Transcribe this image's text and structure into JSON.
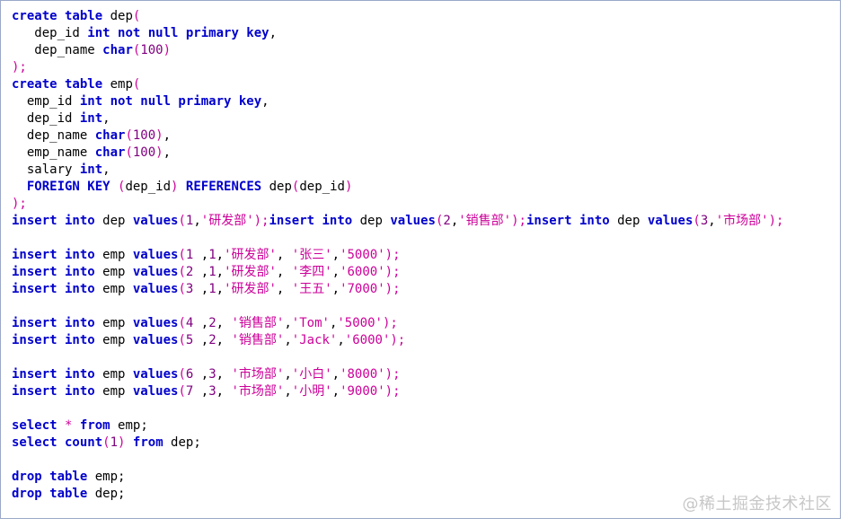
{
  "editor": {
    "lines": [
      [
        {
          "t": "kw",
          "v": "create table"
        },
        {
          "t": "fn",
          "v": " dep"
        },
        {
          "t": "op",
          "v": "("
        }
      ],
      [
        {
          "t": "fn",
          "v": "   dep_id "
        },
        {
          "t": "kw",
          "v": "int not null primary key"
        },
        {
          "t": "punc",
          "v": ","
        }
      ],
      [
        {
          "t": "fn",
          "v": "   dep_name "
        },
        {
          "t": "kw",
          "v": "char"
        },
        {
          "t": "op",
          "v": "("
        },
        {
          "t": "num",
          "v": "100"
        },
        {
          "t": "op",
          "v": ")"
        }
      ],
      [
        {
          "t": "op",
          "v": ");"
        }
      ],
      [
        {
          "t": "kw",
          "v": "create table"
        },
        {
          "t": "fn",
          "v": " emp"
        },
        {
          "t": "op",
          "v": "("
        }
      ],
      [
        {
          "t": "fn",
          "v": "  emp_id "
        },
        {
          "t": "kw",
          "v": "int not null primary key"
        },
        {
          "t": "punc",
          "v": ","
        }
      ],
      [
        {
          "t": "fn",
          "v": "  dep_id "
        },
        {
          "t": "kw",
          "v": "int"
        },
        {
          "t": "punc",
          "v": ","
        }
      ],
      [
        {
          "t": "fn",
          "v": "  dep_name "
        },
        {
          "t": "kw",
          "v": "char"
        },
        {
          "t": "op",
          "v": "("
        },
        {
          "t": "num",
          "v": "100"
        },
        {
          "t": "op",
          "v": ")"
        },
        {
          "t": "punc",
          "v": ","
        }
      ],
      [
        {
          "t": "fn",
          "v": "  emp_name "
        },
        {
          "t": "kw",
          "v": "char"
        },
        {
          "t": "op",
          "v": "("
        },
        {
          "t": "num",
          "v": "100"
        },
        {
          "t": "op",
          "v": ")"
        },
        {
          "t": "punc",
          "v": ","
        }
      ],
      [
        {
          "t": "fn",
          "v": "  salary "
        },
        {
          "t": "kw",
          "v": "int"
        },
        {
          "t": "punc",
          "v": ","
        }
      ],
      [
        {
          "t": "kw",
          "v": "  FOREIGN KEY"
        },
        {
          "t": "fn",
          "v": " "
        },
        {
          "t": "op",
          "v": "("
        },
        {
          "t": "fn",
          "v": "dep_id"
        },
        {
          "t": "op",
          "v": ")"
        },
        {
          "t": "fn",
          "v": " "
        },
        {
          "t": "kw",
          "v": "REFERENCES"
        },
        {
          "t": "fn",
          "v": " dep"
        },
        {
          "t": "op",
          "v": "("
        },
        {
          "t": "fn",
          "v": "dep_id"
        },
        {
          "t": "op",
          "v": ")"
        }
      ],
      [
        {
          "t": "op",
          "v": ");"
        }
      ],
      [
        {
          "t": "kw",
          "v": "insert into"
        },
        {
          "t": "fn",
          "v": " dep "
        },
        {
          "t": "kw",
          "v": "values"
        },
        {
          "t": "op",
          "v": "("
        },
        {
          "t": "num",
          "v": "1"
        },
        {
          "t": "punc",
          "v": ","
        },
        {
          "t": "str",
          "v": "'研发部'"
        },
        {
          "t": "op",
          "v": ");"
        },
        {
          "t": "kw",
          "v": "insert into"
        },
        {
          "t": "fn",
          "v": " dep "
        },
        {
          "t": "kw",
          "v": "values"
        },
        {
          "t": "op",
          "v": "("
        },
        {
          "t": "num",
          "v": "2"
        },
        {
          "t": "punc",
          "v": ","
        },
        {
          "t": "str",
          "v": "'销售部'"
        },
        {
          "t": "op",
          "v": ");"
        },
        {
          "t": "kw",
          "v": "insert into"
        },
        {
          "t": "fn",
          "v": " dep "
        },
        {
          "t": "kw",
          "v": "values"
        },
        {
          "t": "op",
          "v": "("
        },
        {
          "t": "num",
          "v": "3"
        },
        {
          "t": "punc",
          "v": ","
        },
        {
          "t": "str",
          "v": "'市场部'"
        },
        {
          "t": "op",
          "v": ");"
        }
      ],
      [],
      [
        {
          "t": "kw",
          "v": "insert into"
        },
        {
          "t": "fn",
          "v": " emp "
        },
        {
          "t": "kw",
          "v": "values"
        },
        {
          "t": "op",
          "v": "("
        },
        {
          "t": "num",
          "v": "1 "
        },
        {
          "t": "punc",
          "v": ","
        },
        {
          "t": "num",
          "v": "1"
        },
        {
          "t": "punc",
          "v": ","
        },
        {
          "t": "str",
          "v": "'研发部'"
        },
        {
          "t": "punc",
          "v": ", "
        },
        {
          "t": "str",
          "v": "'张三'"
        },
        {
          "t": "punc",
          "v": ","
        },
        {
          "t": "str",
          "v": "'5000'"
        },
        {
          "t": "op",
          "v": ");"
        }
      ],
      [
        {
          "t": "kw",
          "v": "insert into"
        },
        {
          "t": "fn",
          "v": " emp "
        },
        {
          "t": "kw",
          "v": "values"
        },
        {
          "t": "op",
          "v": "("
        },
        {
          "t": "num",
          "v": "2 "
        },
        {
          "t": "punc",
          "v": ","
        },
        {
          "t": "num",
          "v": "1"
        },
        {
          "t": "punc",
          "v": ","
        },
        {
          "t": "str",
          "v": "'研发部'"
        },
        {
          "t": "punc",
          "v": ", "
        },
        {
          "t": "str",
          "v": "'李四'"
        },
        {
          "t": "punc",
          "v": ","
        },
        {
          "t": "str",
          "v": "'6000'"
        },
        {
          "t": "op",
          "v": ");"
        }
      ],
      [
        {
          "t": "kw",
          "v": "insert into"
        },
        {
          "t": "fn",
          "v": " emp "
        },
        {
          "t": "kw",
          "v": "values"
        },
        {
          "t": "op",
          "v": "("
        },
        {
          "t": "num",
          "v": "3 "
        },
        {
          "t": "punc",
          "v": ","
        },
        {
          "t": "num",
          "v": "1"
        },
        {
          "t": "punc",
          "v": ","
        },
        {
          "t": "str",
          "v": "'研发部'"
        },
        {
          "t": "punc",
          "v": ", "
        },
        {
          "t": "str",
          "v": "'王五'"
        },
        {
          "t": "punc",
          "v": ","
        },
        {
          "t": "str",
          "v": "'7000'"
        },
        {
          "t": "op",
          "v": ");"
        }
      ],
      [],
      [
        {
          "t": "kw",
          "v": "insert into"
        },
        {
          "t": "fn",
          "v": " emp "
        },
        {
          "t": "kw",
          "v": "values"
        },
        {
          "t": "op",
          "v": "("
        },
        {
          "t": "num",
          "v": "4 "
        },
        {
          "t": "punc",
          "v": ","
        },
        {
          "t": "num",
          "v": "2"
        },
        {
          "t": "punc",
          "v": ", "
        },
        {
          "t": "str",
          "v": "'销售部'"
        },
        {
          "t": "punc",
          "v": ","
        },
        {
          "t": "str",
          "v": "'Tom'"
        },
        {
          "t": "punc",
          "v": ","
        },
        {
          "t": "str",
          "v": "'5000'"
        },
        {
          "t": "op",
          "v": ");"
        }
      ],
      [
        {
          "t": "kw",
          "v": "insert into"
        },
        {
          "t": "fn",
          "v": " emp "
        },
        {
          "t": "kw",
          "v": "values"
        },
        {
          "t": "op",
          "v": "("
        },
        {
          "t": "num",
          "v": "5 "
        },
        {
          "t": "punc",
          "v": ","
        },
        {
          "t": "num",
          "v": "2"
        },
        {
          "t": "punc",
          "v": ", "
        },
        {
          "t": "str",
          "v": "'销售部'"
        },
        {
          "t": "punc",
          "v": ","
        },
        {
          "t": "str",
          "v": "'Jack'"
        },
        {
          "t": "punc",
          "v": ","
        },
        {
          "t": "str",
          "v": "'6000'"
        },
        {
          "t": "op",
          "v": ");"
        }
      ],
      [],
      [
        {
          "t": "kw",
          "v": "insert into"
        },
        {
          "t": "fn",
          "v": " emp "
        },
        {
          "t": "kw",
          "v": "values"
        },
        {
          "t": "op",
          "v": "("
        },
        {
          "t": "num",
          "v": "6 "
        },
        {
          "t": "punc",
          "v": ","
        },
        {
          "t": "num",
          "v": "3"
        },
        {
          "t": "punc",
          "v": ", "
        },
        {
          "t": "str",
          "v": "'市场部'"
        },
        {
          "t": "punc",
          "v": ","
        },
        {
          "t": "str",
          "v": "'小白'"
        },
        {
          "t": "punc",
          "v": ","
        },
        {
          "t": "str",
          "v": "'8000'"
        },
        {
          "t": "op",
          "v": ");"
        }
      ],
      [
        {
          "t": "kw",
          "v": "insert into"
        },
        {
          "t": "fn",
          "v": " emp "
        },
        {
          "t": "kw",
          "v": "values"
        },
        {
          "t": "op",
          "v": "("
        },
        {
          "t": "num",
          "v": "7 "
        },
        {
          "t": "punc",
          "v": ","
        },
        {
          "t": "num",
          "v": "3"
        },
        {
          "t": "punc",
          "v": ", "
        },
        {
          "t": "str",
          "v": "'市场部'"
        },
        {
          "t": "punc",
          "v": ","
        },
        {
          "t": "str",
          "v": "'小明'"
        },
        {
          "t": "punc",
          "v": ","
        },
        {
          "t": "str",
          "v": "'9000'"
        },
        {
          "t": "op",
          "v": ");"
        }
      ],
      [],
      [
        {
          "t": "kw",
          "v": "select"
        },
        {
          "t": "fn",
          "v": " "
        },
        {
          "t": "op",
          "v": "*"
        },
        {
          "t": "fn",
          "v": " "
        },
        {
          "t": "kw",
          "v": "from"
        },
        {
          "t": "fn",
          "v": " emp;"
        }
      ],
      [
        {
          "t": "kw",
          "v": "select count"
        },
        {
          "t": "op",
          "v": "("
        },
        {
          "t": "num",
          "v": "1"
        },
        {
          "t": "op",
          "v": ")"
        },
        {
          "t": "fn",
          "v": " "
        },
        {
          "t": "kw",
          "v": "from"
        },
        {
          "t": "fn",
          "v": " dep;"
        }
      ],
      [],
      [
        {
          "t": "kw",
          "v": "drop table"
        },
        {
          "t": "fn",
          "v": " emp;"
        }
      ],
      [
        {
          "t": "kw",
          "v": "drop table"
        },
        {
          "t": "fn",
          "v": " dep;"
        }
      ]
    ]
  },
  "watermark": "@稀土掘金技术社区"
}
